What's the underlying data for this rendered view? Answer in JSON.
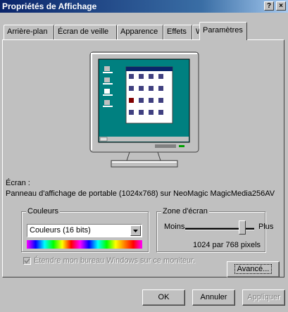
{
  "window": {
    "title": "Propriétés de Affichage",
    "help_button": "?",
    "close_button": "×"
  },
  "tabs": [
    {
      "label": "Arrière-plan",
      "active": false
    },
    {
      "label": "Écran de veille",
      "active": false
    },
    {
      "label": "Apparence",
      "active": false
    },
    {
      "label": "Effets",
      "active": false
    },
    {
      "label": "Web",
      "active": false
    },
    {
      "label": "Paramètres",
      "active": true
    }
  ],
  "display": {
    "label": "Écran :",
    "description": "Panneau d'affichage de portable (1024x768) sur NeoMagic MagicMedia256AV"
  },
  "colors": {
    "group_label": "Couleurs",
    "selected": "Couleurs (16 bits)"
  },
  "screen_area": {
    "group_label": "Zone d'écran",
    "less": "Moins",
    "more": "Plus",
    "value_text": "1024 par 768 pixels",
    "slider_fraction": 0.83
  },
  "extend_checkbox": {
    "label": "Étendre mon bureau Windows sur ce moniteur.",
    "checked": true,
    "disabled": true
  },
  "buttons": {
    "advanced": "Avancé...",
    "ok": "OK",
    "cancel": "Annuler",
    "apply": "Appliquer"
  },
  "preview": {
    "desktop_color": "#008080",
    "icon_labels": [
      "Poste de travail",
      "Voisinage réseau",
      "Corbeille"
    ]
  }
}
